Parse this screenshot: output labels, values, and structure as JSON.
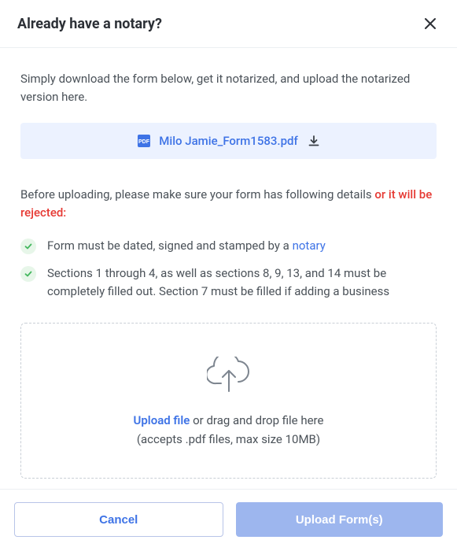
{
  "header": {
    "title": "Already have a notary?"
  },
  "intro": "Simply download the form below, get it notarized, and upload the notarized version here.",
  "download": {
    "filename": "Milo Jamie_Form1583.pdf"
  },
  "warning": {
    "main_text": "Before uploading, please make sure your form has following details ",
    "red_text": "or it will be rejected:"
  },
  "checks": {
    "item0_prefix": "Form must be dated, signed and stamped by a ",
    "item0_link": "notary",
    "item1": "Sections 1 through 4, as well as sections 8, 9, 13, and 14 must be completely filled out. Section 7 must be filled if adding a business"
  },
  "dropzone": {
    "upload_link": "Upload file",
    "main_suffix": " or drag and drop file here",
    "sub": "(accepts .pdf files, max size 10MB)"
  },
  "footer": {
    "cancel": "Cancel",
    "upload": "Upload Form(s)"
  }
}
